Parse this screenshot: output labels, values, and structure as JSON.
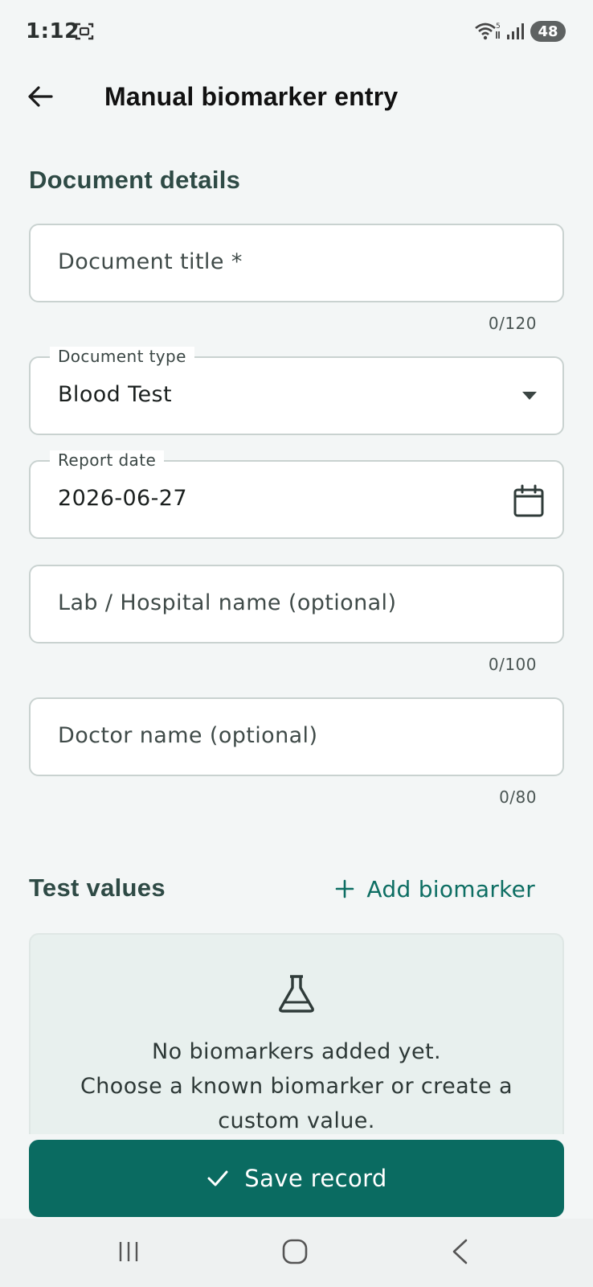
{
  "status_bar": {
    "time": "1:12",
    "battery": "48",
    "icons": [
      "screenshot-icon",
      "wifi-icon",
      "signal-icon"
    ]
  },
  "app_bar": {
    "title": "Manual biomarker entry",
    "back_icon": "arrow-left-icon"
  },
  "document_details": {
    "section_title": "Document details",
    "title_field": {
      "placeholder": "Document title *",
      "counter": "0/120"
    },
    "type_field": {
      "label": "Document type",
      "value": "Blood Test"
    },
    "date_field": {
      "label": "Report date",
      "value": "2026-06-27"
    },
    "lab_field": {
      "placeholder": "Lab / Hospital name (optional)",
      "counter": "0/100"
    },
    "doctor_field": {
      "placeholder": "Doctor name (optional)",
      "counter": "0/80"
    }
  },
  "test_values": {
    "section_title": "Test values",
    "add_label": "Add biomarker",
    "empty": {
      "line1": "No biomarkers added yet.",
      "line2": "Choose a known biomarker or create a",
      "line3": "custom value."
    }
  },
  "save_button": {
    "label": "Save record"
  },
  "colors": {
    "primary": "#0a6b61",
    "background": "#f3f6f6",
    "card": "#e8f0ee"
  }
}
